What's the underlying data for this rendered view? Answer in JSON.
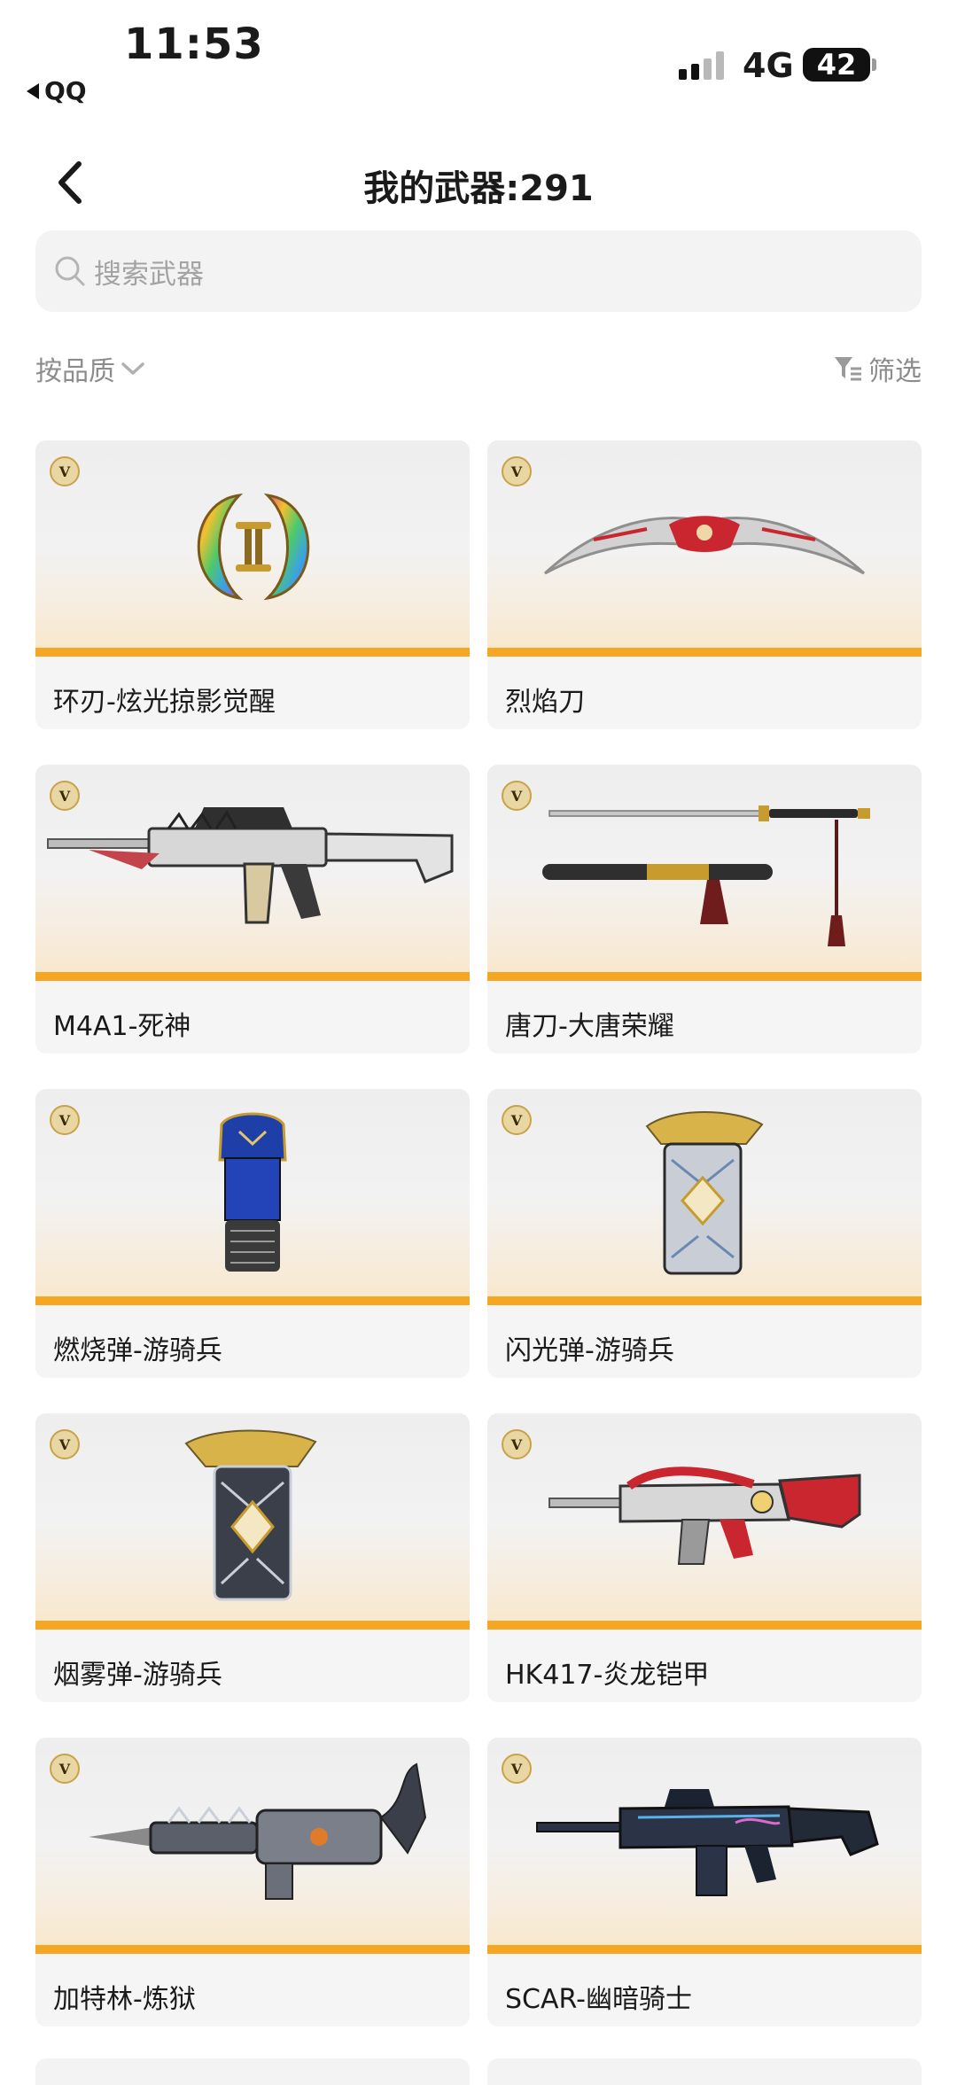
{
  "status": {
    "time": "11:53",
    "back_app": "QQ",
    "network": "4G",
    "battery": "42"
  },
  "header": {
    "title": "我的武器:291"
  },
  "search": {
    "placeholder": "搜索武器"
  },
  "filters": {
    "sort_label": "按品质",
    "filter_label": "筛选"
  },
  "badge_letter": "V",
  "weapons": [
    {
      "name": "环刃-炫光掠影觉醒",
      "icon": "ring-blade-icon"
    },
    {
      "name": "烈焰刀",
      "icon": "curved-blade-icon"
    },
    {
      "name": "M4A1-死神",
      "icon": "rifle-icon"
    },
    {
      "name": "唐刀-大唐荣耀",
      "icon": "katana-icon"
    },
    {
      "name": "燃烧弹-游骑兵",
      "icon": "grenade-icon"
    },
    {
      "name": "闪光弹-游骑兵",
      "icon": "grenade-icon"
    },
    {
      "name": "烟雾弹-游骑兵",
      "icon": "grenade-icon"
    },
    {
      "name": "HK417-炎龙铠甲",
      "icon": "rifle-icon"
    },
    {
      "name": "加特林-炼狱",
      "icon": "gatling-icon"
    },
    {
      "name": "SCAR-幽暗骑士",
      "icon": "rifle-icon"
    }
  ],
  "colors": {
    "accent_bar": "#f5a623",
    "card_bg": "#f5f5f5"
  }
}
